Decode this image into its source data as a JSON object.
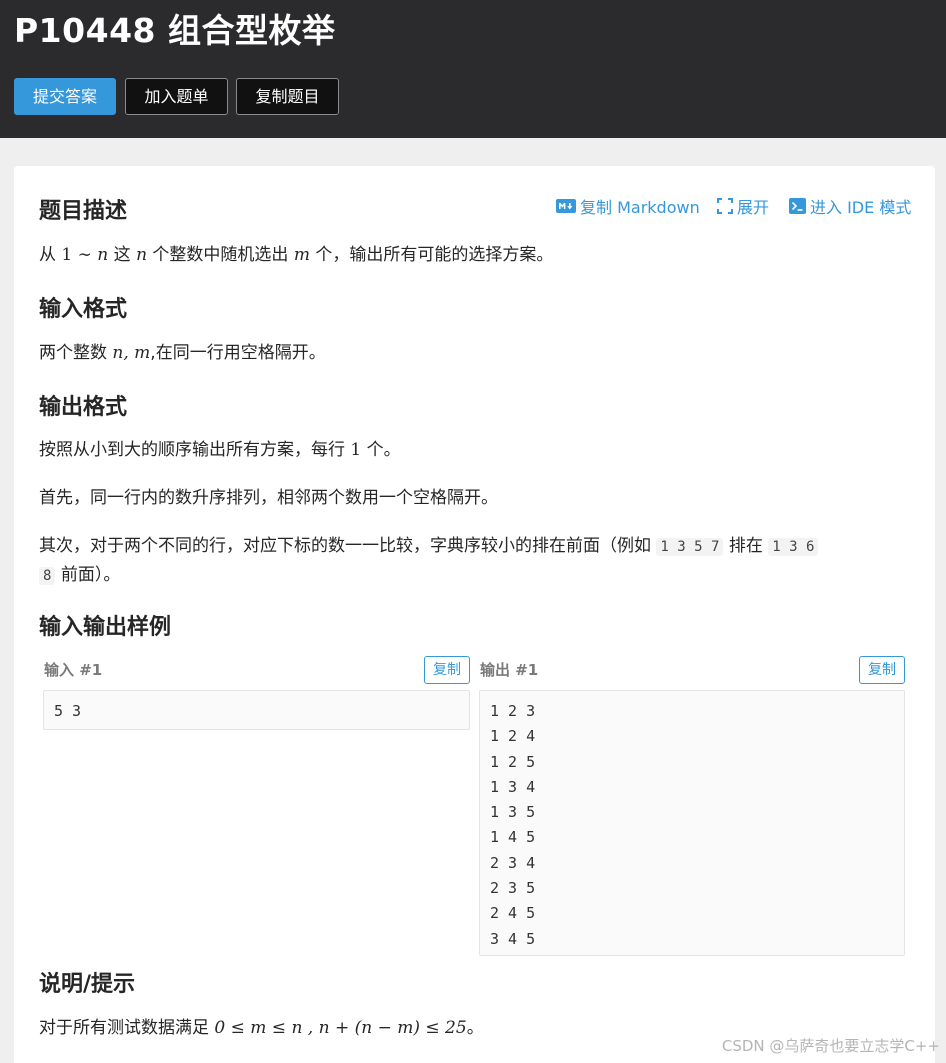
{
  "header": {
    "title": "P10448 组合型枚举",
    "buttons": {
      "submit": "提交答案",
      "add_to_list": "加入题单",
      "copy_problem": "复制题目"
    }
  },
  "toolbar": {
    "copy_markdown": "复制 Markdown",
    "expand": "展开",
    "ide_mode": "进入 IDE 模式"
  },
  "sections": {
    "description": {
      "heading": "题目描述",
      "text": {
        "p1": "从",
        "m1": "1",
        "p2": "∼",
        "m2": "n",
        "p3": "这",
        "m3": "n",
        "p4": "个整数中随机选出",
        "m4": "m",
        "p5": "个，输出所有可能的选择方案。"
      }
    },
    "input_format": {
      "heading": "输入格式",
      "text": {
        "p1": "两个整数",
        "m1": "n, m",
        "p2": ",在同一行用空格隔开。"
      }
    },
    "output_format": {
      "heading": "输出格式",
      "para1": {
        "p1": "按照从小到大的顺序输出所有方案，每行",
        "m1": "1",
        "p2": "个。"
      },
      "para2": "首先，同一行内的数升序排列，相邻两个数用一个空格隔开。",
      "para3": {
        "p1": "其次，对于两个不同的行，对应下标的数一一比较，字典序较小的排在前面（例如",
        "c1": "1 3 5 7",
        "p2": "排在",
        "c2a": "1 3 6",
        "c2b": "8",
        "p3": "前面）。"
      }
    },
    "samples": {
      "heading": "输入输出样例",
      "input_label": "输入 #1",
      "output_label": "输出 #1",
      "copy_label": "复制",
      "input": "5 3",
      "output": "1 2 3\n1 2 4\n1 2 5\n1 3 4\n1 3 5\n1 4 5\n2 3 4\n2 3 5\n2 4 5\n3 4 5"
    },
    "hint": {
      "heading": "说明/提示",
      "text": {
        "p1": "对于所有测试数据满足",
        "m1": "0 ≤ m ≤ n , n + (n − m) ≤ 25",
        "p2": "。"
      }
    }
  },
  "watermark": "CSDN @乌萨奇也要立志学C++",
  "colors": {
    "header_bg": "#2b2b2d",
    "accent": "#3498db",
    "page_bg": "#efefef",
    "card_bg": "#ffffff"
  },
  "icons": {
    "markdown": "markdown-icon",
    "expand": "expand-icon",
    "ide": "terminal-icon"
  }
}
